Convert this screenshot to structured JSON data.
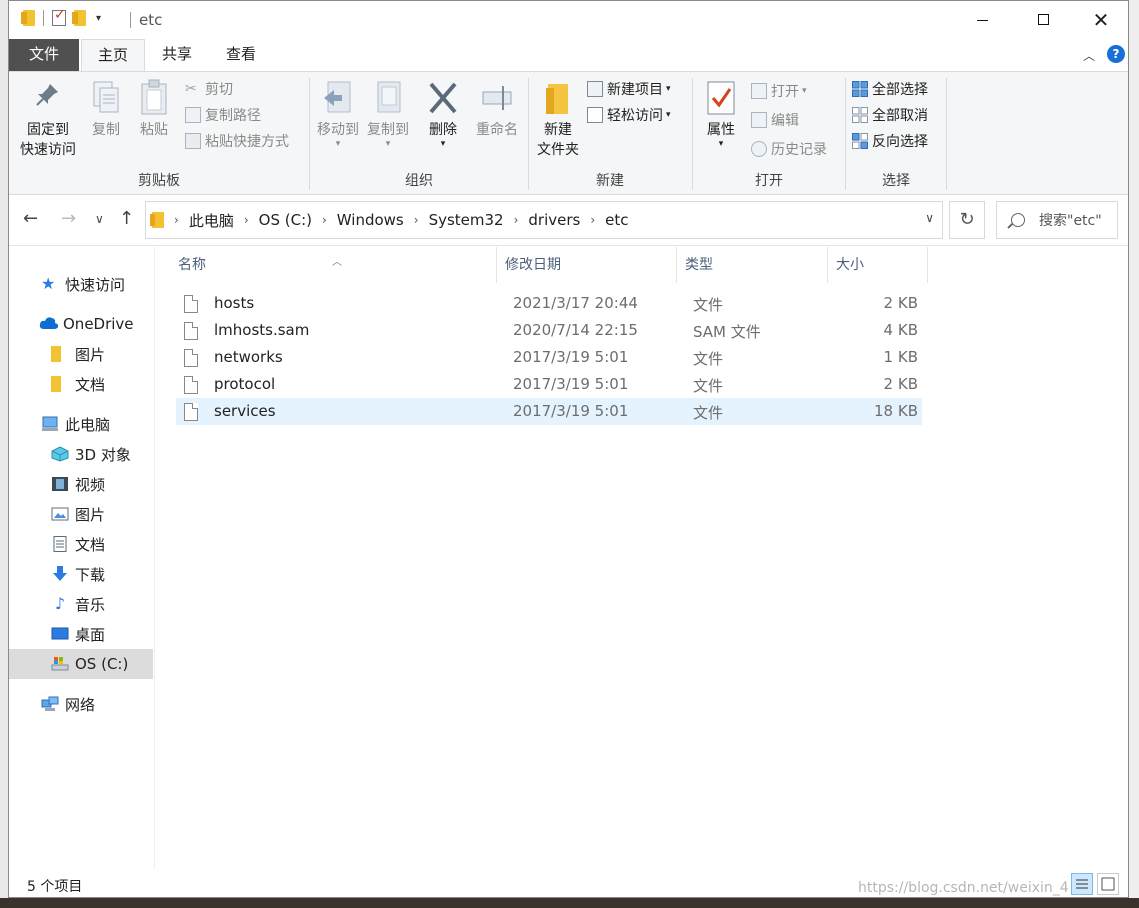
{
  "window": {
    "title": "etc"
  },
  "tabs": {
    "file": "文件",
    "home": "主页",
    "share": "共享",
    "view": "查看"
  },
  "help": "?",
  "ribbon": {
    "clipboard": {
      "label": "剪贴板",
      "pin_line1": "固定到",
      "pin_line2": "快速访问",
      "copy": "复制",
      "paste": "粘贴",
      "cut": "剪切",
      "copy_path": "复制路径",
      "paste_shortcut": "粘贴快捷方式"
    },
    "organize": {
      "label": "组织",
      "move_to": "移动到",
      "copy_to": "复制到",
      "delete": "删除",
      "rename": "重命名"
    },
    "new": {
      "label": "新建",
      "new_folder_line1": "新建",
      "new_folder_line2": "文件夹",
      "new_item": "新建项目",
      "easy_access": "轻松访问"
    },
    "open": {
      "label": "打开",
      "properties": "属性",
      "open": "打开",
      "edit": "编辑",
      "history": "历史记录"
    },
    "select": {
      "label": "选择",
      "select_all": "全部选择",
      "select_none": "全部取消",
      "invert": "反向选择"
    }
  },
  "address": {
    "crumbs": [
      "此电脑",
      "OS (C:)",
      "Windows",
      "System32",
      "drivers",
      "etc"
    ],
    "search_placeholder": "搜索\"etc\""
  },
  "navpane": {
    "quick_access": "快速访问",
    "onedrive": "OneDrive",
    "onedrive_pictures": "图片",
    "onedrive_documents": "文档",
    "this_pc": "此电脑",
    "objects3d": "3D 对象",
    "videos": "视频",
    "pictures": "图片",
    "documents": "文档",
    "downloads": "下载",
    "music": "音乐",
    "desktop": "桌面",
    "os_c": "OS (C:)",
    "network": "网络"
  },
  "columns": {
    "name": "名称",
    "modified": "修改日期",
    "type": "类型",
    "size": "大小"
  },
  "files": [
    {
      "name": "hosts",
      "modified": "2021/3/17 20:44",
      "type": "文件",
      "size": "2 KB"
    },
    {
      "name": "lmhosts.sam",
      "modified": "2020/7/14 22:15",
      "type": "SAM 文件",
      "size": "4 KB"
    },
    {
      "name": "networks",
      "modified": "2017/3/19 5:01",
      "type": "文件",
      "size": "1 KB"
    },
    {
      "name": "protocol",
      "modified": "2017/3/19 5:01",
      "type": "文件",
      "size": "2 KB"
    },
    {
      "name": "services",
      "modified": "2017/3/19 5:01",
      "type": "文件",
      "size": "18 KB"
    }
  ],
  "status": {
    "item_count": "5 个项目"
  },
  "watermark": "https://blog.csdn.net/weixin_4",
  "colors": {
    "file_tab": "#505050",
    "selection": "#e5f3ff",
    "nav_selected": "#dcdcdc",
    "accent": "#1a6fd6"
  }
}
